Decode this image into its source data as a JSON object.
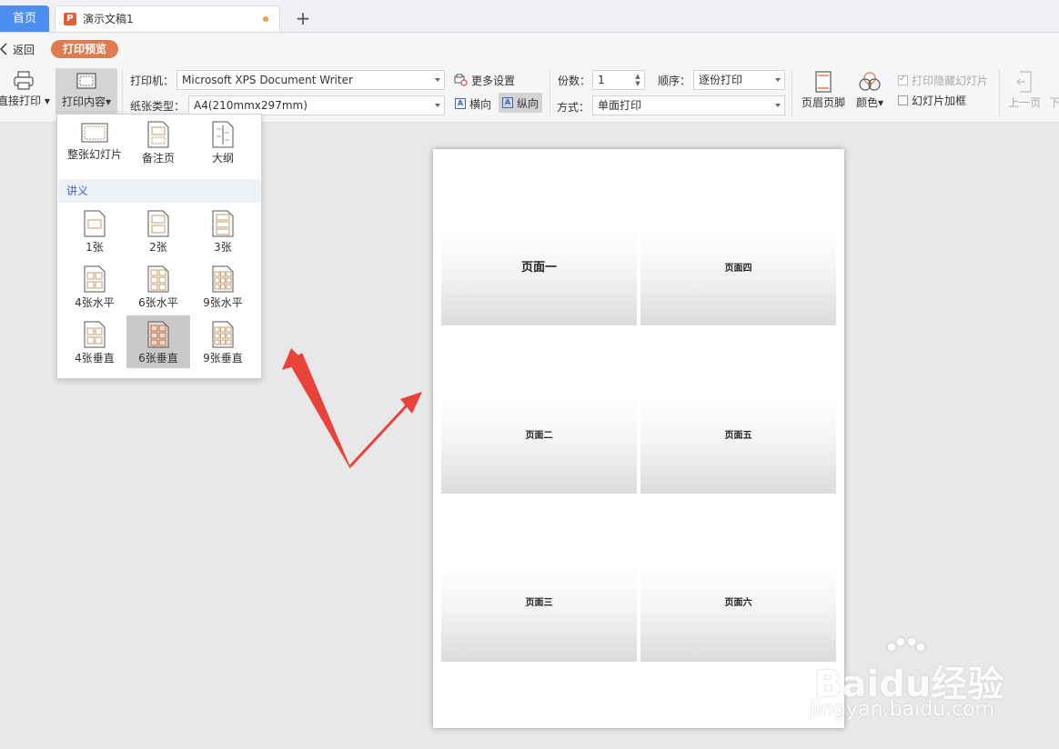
{
  "tabs": {
    "home_label": "首页",
    "doc_title": "演示文稿1",
    "doc_icon_letter": "P",
    "add_symbol": "+"
  },
  "subbar": {
    "back_label": "返回",
    "mode_badge": "打印预览"
  },
  "ribbon": {
    "direct_print": "直接打印",
    "print_content": "打印内容",
    "printer_label": "打印机：",
    "printer_value": "Microsoft XPS Document Writer",
    "paper_label": "纸张类型：",
    "paper_value": "A4(210mmx297mm)",
    "more_settings": "更多设置",
    "landscape": "横向",
    "portrait": "纵向",
    "copies_label": "份数：",
    "copies_value": "1",
    "order_label": "顺序：",
    "order_value": "逐份打印",
    "mode_label": "方式：",
    "mode_value": "单面打印",
    "header_footer": "页眉页脚",
    "color": "颜色",
    "print_hidden": "打印隐藏幻灯片",
    "slide_frame": "幻灯片加框",
    "prev_page": "上一页",
    "next_page": "下"
  },
  "dropdown": {
    "top_items": [
      "整张幻灯片",
      "备注页",
      "大纲"
    ],
    "section_label": "讲义",
    "handout_items": [
      "1张",
      "2张",
      "3张",
      "4张水平",
      "6张水平",
      "9张水平",
      "4张垂直",
      "6张垂直",
      "9张垂直"
    ],
    "selected": "6张垂直"
  },
  "preview": {
    "slides": [
      "页面一",
      "页面四",
      "页面二",
      "页面五",
      "页面三",
      "页面六"
    ]
  },
  "watermark": {
    "main": "Baidu经验",
    "sub": "jingyan.baidu.com"
  },
  "colors": {
    "home_tab": "#4d8ff0",
    "badge": "#e07a4f",
    "arrow": "#e8433a",
    "link_blue": "#3a66c7"
  }
}
